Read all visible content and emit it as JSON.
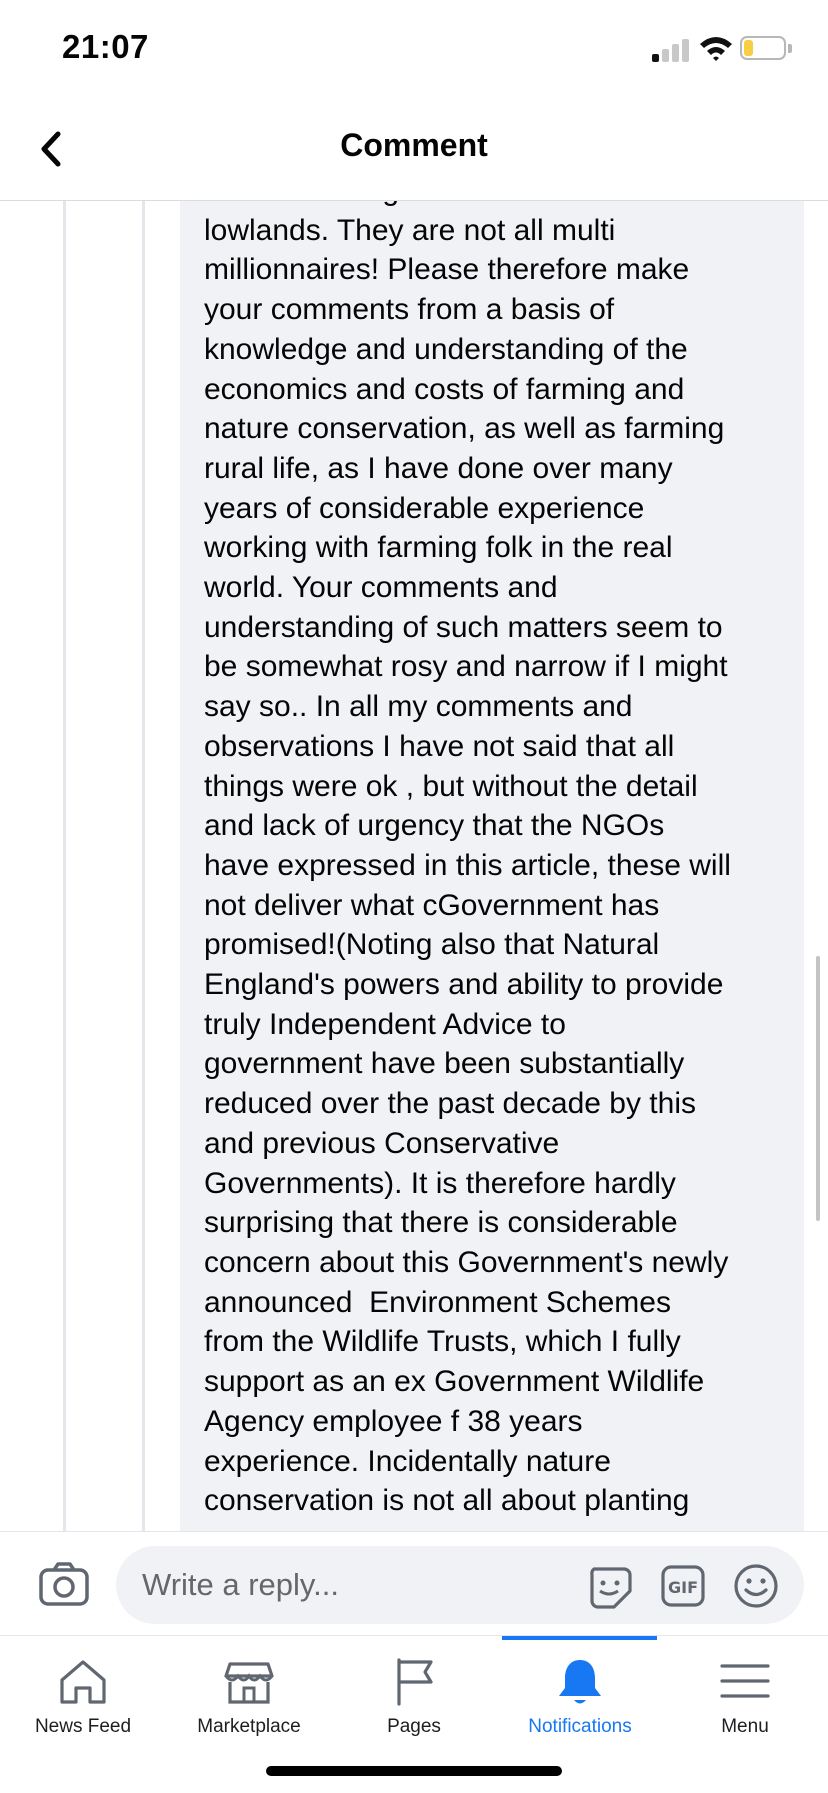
{
  "status_bar": {
    "time": "21:07",
    "battery_color": "#f7ce46"
  },
  "header": {
    "title": "Comment",
    "back_icon": "chevron-left-icon"
  },
  "comment": {
    "lines": [
      "farmers throughout the UK in the",
      "lowlands. They are not all multi",
      "millionnaires! Please therefore make",
      "your comments from a basis of",
      "knowledge and understanding of the",
      "economics and costs of farming and",
      "nature conservation, as well as farming",
      "rural life, as I have done over many",
      "years of considerable experience",
      "working with farming folk in the real",
      "world. Your comments and",
      "understanding of such matters seem to",
      "be somewhat rosy and narrow if I might",
      "say so.. In all my comments and",
      "observations I have not said that all",
      "things were ok , but without the detail",
      "and lack of urgency that the NGOs",
      "have expressed in this article, these will",
      "not deliver what cGovernment has",
      "promised!(Noting also that Natural",
      "England's powers and ability to provide",
      "truly Independent Advice to",
      "government have been substantially",
      "reduced over the past decade by this",
      "and previous Conservative",
      "Governments). It is therefore hardly",
      "surprising that there is considerable",
      "concern about this Government's newly",
      "announced  Environment Schemes",
      "from the Wildlife Trusts, which I fully",
      "support as an ex Government Wildlife",
      "Agency employee f 38 years",
      "experience. Incidentally nature",
      "conservation is not all about planting"
    ]
  },
  "composer": {
    "placeholder": "Write a reply...",
    "icons": [
      "camera-icon",
      "sticker-icon",
      "gif-icon",
      "emoji-icon"
    ]
  },
  "tabbar": {
    "active_color": "#1877f2",
    "tabs": [
      {
        "label": "News Feed",
        "icon": "home-icon"
      },
      {
        "label": "Marketplace",
        "icon": "marketplace-icon"
      },
      {
        "label": "Pages",
        "icon": "flag-icon"
      },
      {
        "label": "Notifications",
        "icon": "bell-icon",
        "active": true
      },
      {
        "label": "Menu",
        "icon": "menu-icon"
      }
    ]
  }
}
